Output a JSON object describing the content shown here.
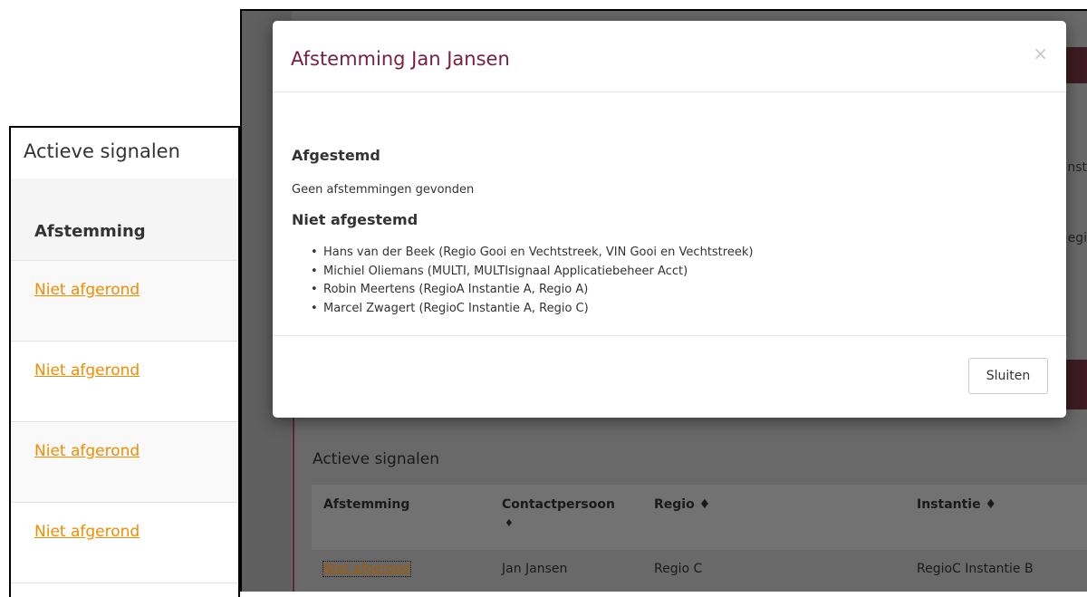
{
  "left_panel": {
    "title": "Actieve signalen",
    "column_header": "Afstemming",
    "rows": [
      "Niet afgerond",
      "Niet afgerond",
      "Niet afgerond",
      "Niet afgerond"
    ]
  },
  "background": {
    "side_texts": [
      "nst",
      "egi"
    ],
    "section_title": "Actieve signalen",
    "table_headers": [
      "Afstemming",
      "Contactpersoon",
      "♦",
      "Regio ♦",
      "Instantie ♦"
    ],
    "row": {
      "afstemming": "Niet afgerond",
      "contactpersoon": "Jan Jansen",
      "regio": "Regio C",
      "instantie": "RegioC Instantie B"
    },
    "colors": {
      "link": "#a35a00",
      "accent": "#5a2732"
    }
  },
  "modal": {
    "title": "Afstemming Jan Jansen",
    "close_icon": "×",
    "afgestemd_heading": "Afgestemd",
    "afgestemd_empty": "Geen afstemmingen gevonden",
    "niet_afgestemd_heading": "Niet afgestemd",
    "niet_afgestemd_items": [
      "Hans van der Beek (Regio Gooi en Vechtstreek, VIN Gooi en Vechtstreek)",
      "Michiel Oliemans (MULTI, MULTIsignaal Applicatiebeheer Acct)",
      "Robin Meertens (RegioA Instantie A, Regio A)",
      "Marcel Zwagert (RegioC Instantie A, Regio C)"
    ],
    "close_button": "Sluiten",
    "colors": {
      "title": "#7a1f3a"
    }
  }
}
